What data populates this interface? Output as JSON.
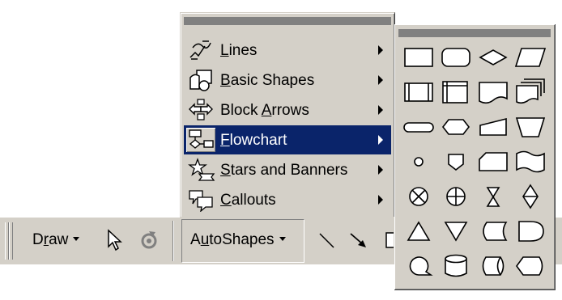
{
  "autoshapes_menu": {
    "items": [
      {
        "label_pre": "",
        "label_u": "L",
        "label_post": "ines",
        "icon": "lines-icon",
        "active": false
      },
      {
        "label_pre": "",
        "label_u": "B",
        "label_post": "asic Shapes",
        "icon": "basic-shapes-icon",
        "active": false
      },
      {
        "label_pre": "Block ",
        "label_u": "A",
        "label_post": "rrows",
        "icon": "block-arrows-icon",
        "active": false
      },
      {
        "label_pre": "",
        "label_u": "F",
        "label_post": "lowchart",
        "icon": "flowchart-icon",
        "active": true
      },
      {
        "label_pre": "",
        "label_u": "S",
        "label_post": "tars and Banners",
        "icon": "stars-banners-icon",
        "active": false
      },
      {
        "label_pre": "",
        "label_u": "C",
        "label_post": "allouts",
        "icon": "callouts-icon",
        "active": false
      }
    ]
  },
  "flowchart_submenu": {
    "shapes": [
      "process",
      "alternate-process",
      "decision",
      "data",
      "predefined-process",
      "internal-storage",
      "document",
      "multidocument",
      "terminator",
      "preparation",
      "manual-input",
      "manual-operation",
      "connector",
      "off-page-connector",
      "card",
      "punched-tape",
      "summing-junction",
      "or",
      "collate",
      "sort",
      "extract",
      "merge",
      "stored-data",
      "delay",
      "sequential-access-storage",
      "magnetic-disk",
      "direct-access-storage",
      "display"
    ]
  },
  "toolbar": {
    "draw_pre": "D",
    "draw_u": "r",
    "draw_post": "aw",
    "autoshapes_pre": "A",
    "autoshapes_u": "u",
    "autoshapes_post": "toShapes",
    "icons": [
      "select-objects-icon",
      "free-rotate-icon",
      "line-icon",
      "arrow-icon",
      "rectangle-icon"
    ]
  },
  "colors": {
    "face": "#d4d0c8",
    "highlight": "#0a246a",
    "titlebar": "#808080"
  }
}
